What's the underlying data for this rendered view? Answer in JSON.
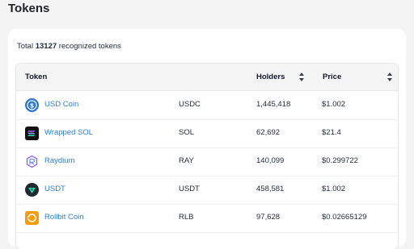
{
  "page": {
    "title": "Tokens"
  },
  "summary": {
    "prefix": "Total",
    "count": "13127",
    "suffix": "recognized tokens"
  },
  "table": {
    "headers": {
      "token": "Token",
      "holders": "Holders",
      "price": "Price"
    },
    "rows": [
      {
        "name": "USD Coin",
        "symbol": "USDC",
        "holders": "1,445,418",
        "price": "$1.002",
        "icon": "usd-coin-icon"
      },
      {
        "name": "Wrapped SOL",
        "symbol": "SOL",
        "holders": "62,692",
        "price": "$21.4",
        "icon": "wrapped-sol-icon"
      },
      {
        "name": "Raydium",
        "symbol": "RAY",
        "holders": "140,099",
        "price": "$0.299722",
        "icon": "raydium-icon"
      },
      {
        "name": "USDT",
        "symbol": "USDT",
        "holders": "458,581",
        "price": "$1.002",
        "icon": "usdt-icon"
      },
      {
        "name": "Rollbit Coin",
        "symbol": "RLB",
        "holders": "97,628",
        "price": "$0.02665129",
        "icon": "rollbit-icon"
      }
    ]
  },
  "colors": {
    "link": "#2d7fd3",
    "background": "#f4f4f5",
    "header_bg": "#f5f5f6"
  }
}
